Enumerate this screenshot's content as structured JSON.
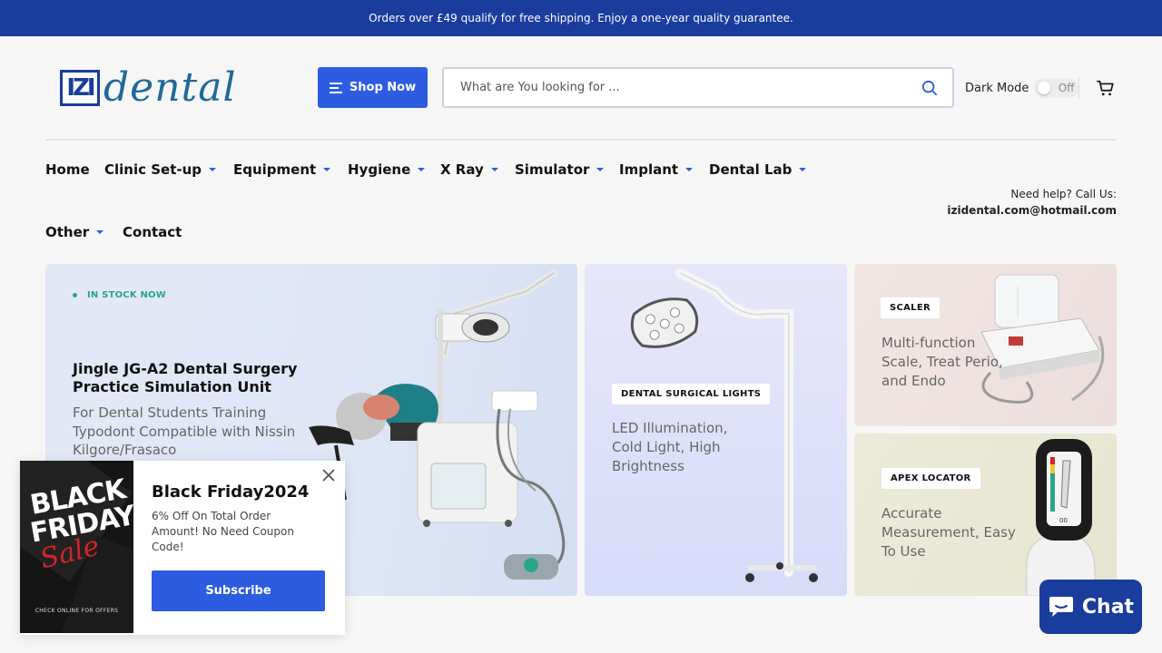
{
  "topbar": {
    "text": "Orders over £49 qualify for free shipping. Enjoy a one-year quality guarantee."
  },
  "logo": {
    "mark": "IZI",
    "text": "dental"
  },
  "header": {
    "shop_now": "Shop Now",
    "search_placeholder": "What are You looking for ...",
    "dark_mode_label": "Dark Mode",
    "dark_mode_state": "Off"
  },
  "nav": {
    "items": [
      {
        "label": "Home"
      },
      {
        "label": "Clinic Set-up"
      },
      {
        "label": "Equipment"
      },
      {
        "label": "Hygiene"
      },
      {
        "label": "X Ray"
      },
      {
        "label": "Simulator"
      },
      {
        "label": "Implant"
      },
      {
        "label": "Dental Lab"
      },
      {
        "label": "Other"
      },
      {
        "label": "Contact"
      }
    ]
  },
  "help": {
    "label": "Need help? Call Us:",
    "email": "izidental.com@hotmail.com"
  },
  "hero": {
    "badge": "IN STOCK NOW",
    "title": "Jingle JG-A2 Dental Surgery Practice Simulation Unit",
    "subtitle": "For Dental Students Training Typodont Compatible with Nissin Kilgore/Frasaco"
  },
  "cards": {
    "lights": {
      "tag": "DENTAL SURGICAL LIGHTS",
      "desc": "LED Illumination, Cold Light, High Brightness"
    },
    "scaler": {
      "tag": "SCALER",
      "desc": "Multi-function Scale, Treat Perio, and Endo"
    },
    "apex": {
      "tag": "APEX LOCATOR",
      "desc": "Accurate Measurement, Easy To Use"
    }
  },
  "popup": {
    "image_line1": "BLACK",
    "image_line2": "FRIDAY",
    "image_script": "Sale",
    "image_footer": "CHECK ONLINE FOR OFFERS",
    "title": "Black Friday2024",
    "text": "6% Off On Total Order Amount! No Need Coupon Code!",
    "button": "Subscribe"
  },
  "chat": {
    "label": "Chat"
  },
  "colors": {
    "primary": "#2e5ce0",
    "navy": "#1a3c9c",
    "stock_green": "#2aa58a"
  }
}
